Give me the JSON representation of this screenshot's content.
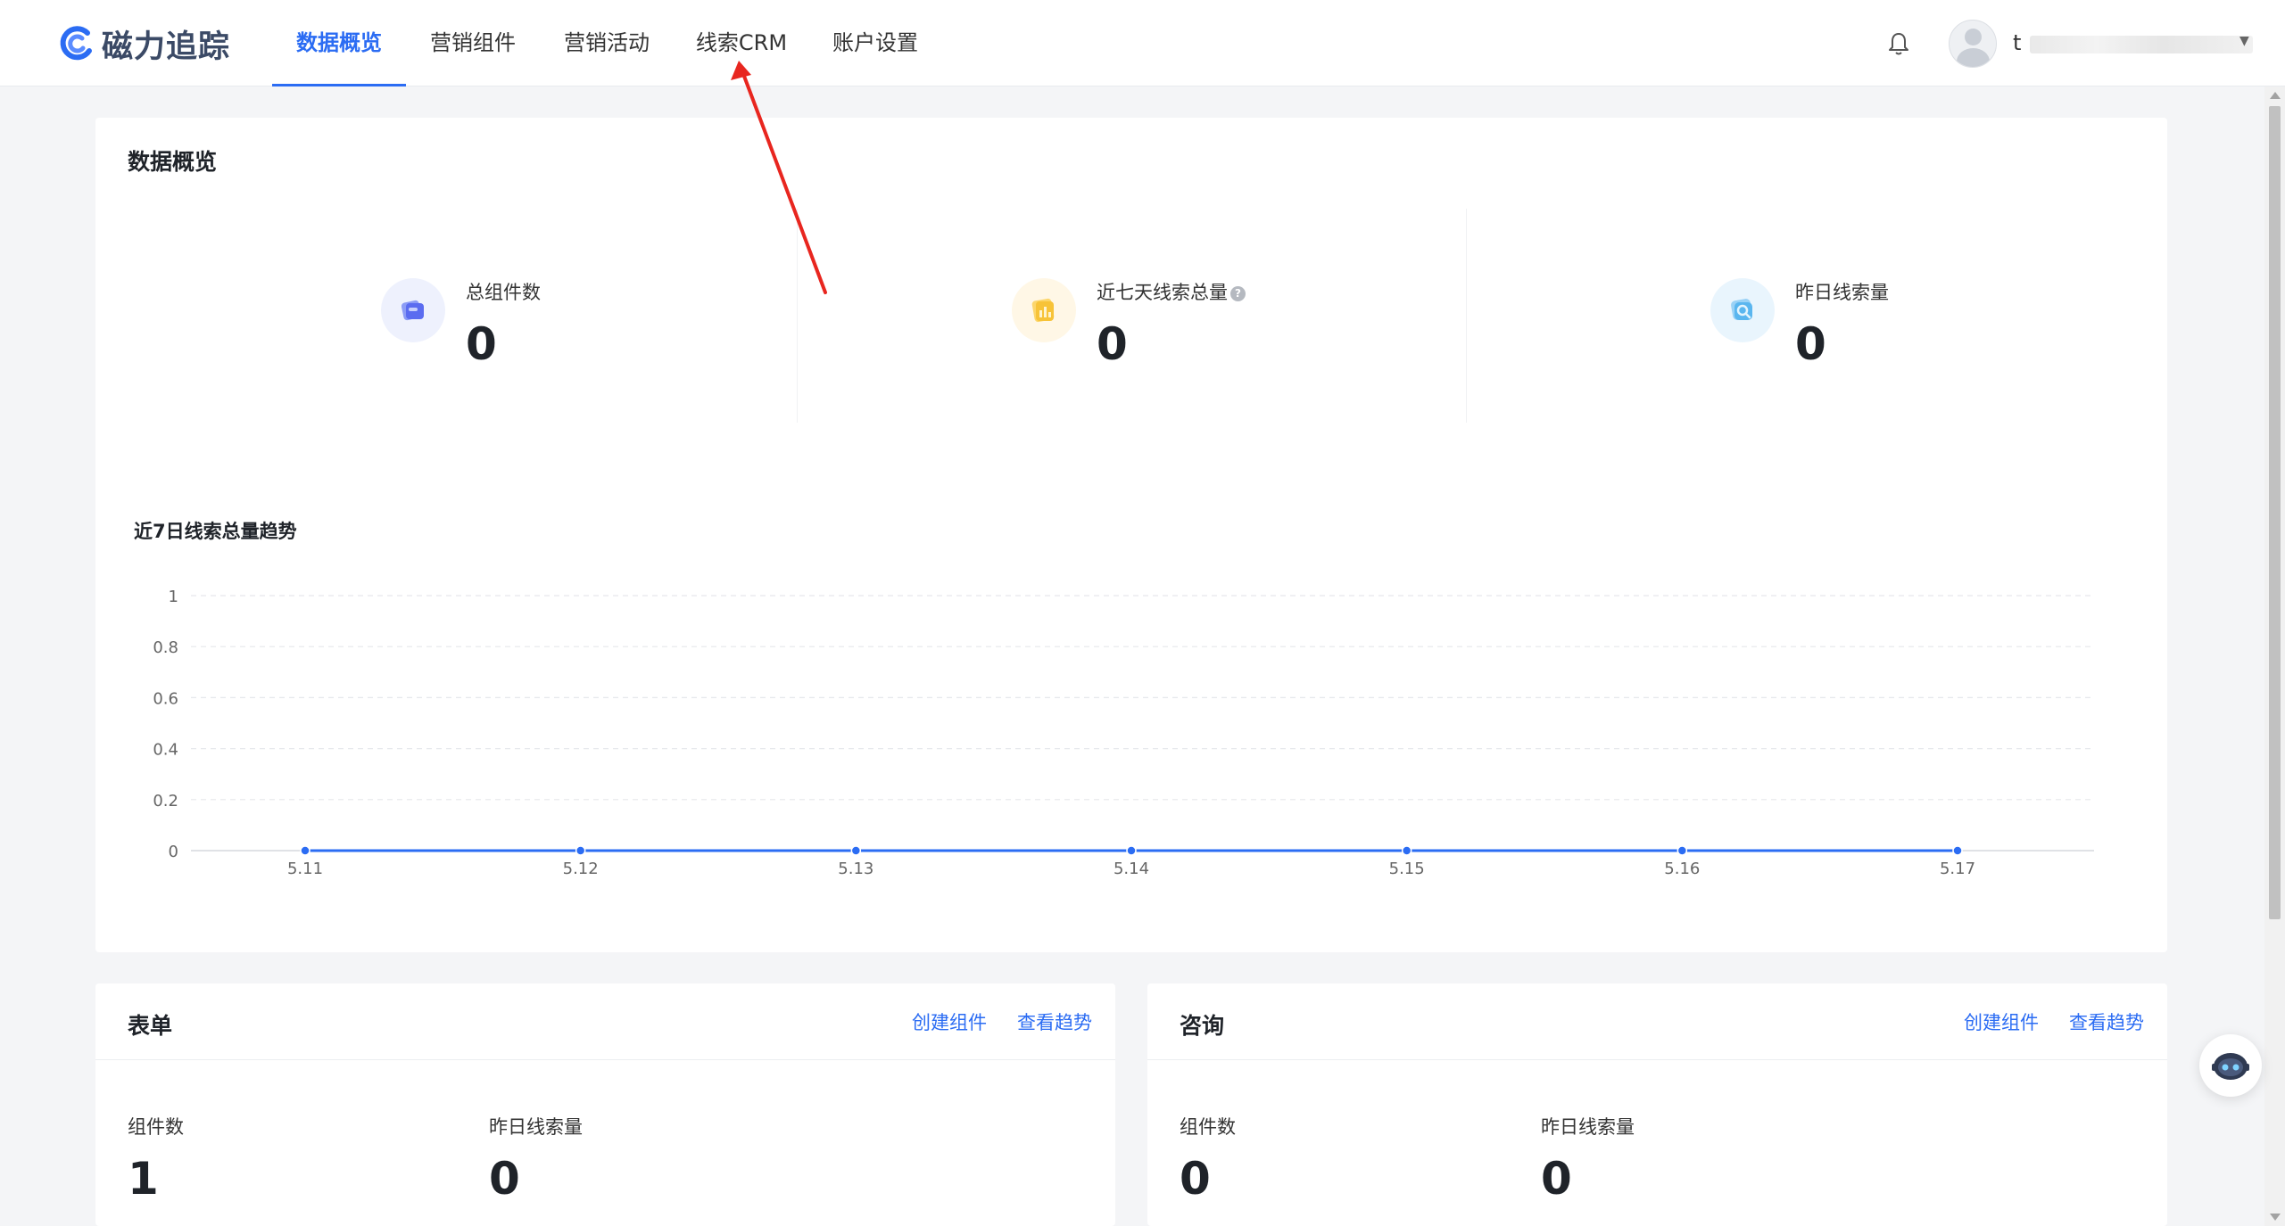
{
  "app": {
    "logo_text": "磁力追踪",
    "brand_color": "#2b6cf3"
  },
  "nav": {
    "items": [
      {
        "label": "数据概览",
        "active": true
      },
      {
        "label": "营销组件",
        "active": false
      },
      {
        "label": "营销活动",
        "active": false
      },
      {
        "label": "线索CRM",
        "active": false
      },
      {
        "label": "账户设置",
        "active": false
      }
    ]
  },
  "user": {
    "name_visible": "t",
    "notification_icon": "bell-icon",
    "avatar_icon": "user-avatar-icon"
  },
  "overview": {
    "title": "数据概览",
    "stats": [
      {
        "label": "总组件数",
        "value": "0",
        "icon": "components-icon",
        "has_help": false
      },
      {
        "label": "近七天线索总量",
        "value": "0",
        "icon": "bar-chart-icon",
        "has_help": true
      },
      {
        "label": "昨日线索量",
        "value": "0",
        "icon": "magnifier-icon",
        "has_help": false
      }
    ]
  },
  "chart_data": {
    "type": "line",
    "title": "近7日线索总量趋势",
    "categories": [
      "5.11",
      "5.12",
      "5.13",
      "5.14",
      "5.15",
      "5.16",
      "5.17"
    ],
    "series": [
      {
        "values": [
          0,
          0,
          0,
          0,
          0,
          0,
          0
        ],
        "color": "#2b6cf3"
      }
    ],
    "yticks": [
      "0",
      "0.2",
      "0.4",
      "0.6",
      "0.8",
      "1"
    ],
    "ylim": [
      0,
      1
    ],
    "grid": true,
    "legend": "none"
  },
  "form_card": {
    "title": "表单",
    "create_link": "创建组件",
    "trend_link": "查看趋势",
    "count_label": "组件数",
    "count_value": "1",
    "yesterday_label": "昨日线索量",
    "yesterday_value": "0"
  },
  "consult_card": {
    "title": "咨询",
    "create_link": "创建组件",
    "trend_link": "查看趋势",
    "count_label": "组件数",
    "count_value": "0",
    "yesterday_label": "昨日线索量",
    "yesterday_value": "0"
  },
  "assistant": {
    "icon": "robot-assistant-icon"
  }
}
